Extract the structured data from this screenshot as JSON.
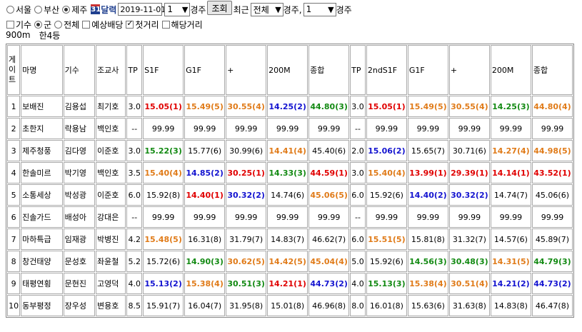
{
  "controls": {
    "regions": [
      {
        "label": "서울",
        "checked": false
      },
      {
        "label": "부산",
        "checked": false
      },
      {
        "label": "제주",
        "checked": true
      }
    ],
    "calendar_icon_text": "31",
    "calendar_label": "달력",
    "date_value": "2019-11-01",
    "race_no": "1",
    "race_label": "경주",
    "search_button": "조회",
    "recent_label": "최근",
    "recent_value": "전체",
    "recent_suffix": "경주,",
    "race_count": "1",
    "race_count_suffix": "경주"
  },
  "filters": [
    {
      "type": "checkbox",
      "label": "기수",
      "checked": false
    },
    {
      "type": "radio",
      "label": "군",
      "checked": true
    },
    {
      "type": "radio",
      "label": "전체",
      "checked": false
    },
    {
      "type": "checkbox",
      "label": "예상배당",
      "checked": false
    },
    {
      "type": "checkbox",
      "label": "첫거리",
      "checked": true
    },
    {
      "type": "checkbox",
      "label": "해당거리",
      "checked": false
    }
  ],
  "race_info": {
    "distance": "900m",
    "grade": "한4등"
  },
  "table": {
    "headers": [
      "게\n이\n트",
      "마명",
      "기수",
      "조교사",
      "TP",
      "S1F",
      "G1F",
      "+",
      "200M",
      "종합",
      "TP",
      "2ndS1F",
      "G1F",
      "+",
      "200M",
      "종합"
    ],
    "rows": [
      {
        "gate": "1",
        "horse": "보배진",
        "jockey": "김용섭",
        "trainer": "최기호",
        "tp": "3.0",
        "cells": [
          [
            "15.05(1)",
            "red"
          ],
          [
            "15.49(5)",
            "orange"
          ],
          [
            "30.55(4)",
            "orange"
          ],
          [
            "14.25(2)",
            "blue"
          ],
          [
            "44.80(3)",
            "green"
          ]
        ],
        "tp2": "3.0",
        "cells2": [
          [
            "15.05(1)",
            "red"
          ],
          [
            "15.49(5)",
            "orange"
          ],
          [
            "30.55(4)",
            "orange"
          ],
          [
            "14.25(3)",
            "green"
          ],
          [
            "44.80(4)",
            "orange"
          ]
        ]
      },
      {
        "gate": "2",
        "horse": "초한지",
        "jockey": "락용남",
        "trainer": "백인호",
        "tp": "--",
        "cells": [
          [
            "99.99",
            "n"
          ],
          [
            "99.99",
            "n"
          ],
          [
            "99.99",
            "n"
          ],
          [
            "99.99",
            "n"
          ],
          [
            "99.99",
            "n"
          ]
        ],
        "tp2": "--",
        "cells2": [
          [
            "99.99",
            "n"
          ],
          [
            "99.99",
            "n"
          ],
          [
            "99.99",
            "n"
          ],
          [
            "99.99",
            "n"
          ],
          [
            "99.99",
            "n"
          ]
        ]
      },
      {
        "gate": "3",
        "horse": "제주청풍",
        "jockey": "김다영",
        "trainer": "이준호",
        "tp": "3.0",
        "cells": [
          [
            "15.22(3)",
            "green"
          ],
          [
            "15.77(6)",
            "n"
          ],
          [
            "30.99(6)",
            "n"
          ],
          [
            "14.41(4)",
            "orange"
          ],
          [
            "45.40(6)",
            "n"
          ]
        ],
        "tp2": "2.0",
        "cells2": [
          [
            "15.06(2)",
            "blue"
          ],
          [
            "15.65(7)",
            "n"
          ],
          [
            "30.71(6)",
            "n"
          ],
          [
            "14.27(4)",
            "orange"
          ],
          [
            "44.98(5)",
            "orange"
          ]
        ]
      },
      {
        "gate": "4",
        "horse": "한솔미르",
        "jockey": "박기영",
        "trainer": "백인호",
        "tp": "3.5",
        "cells": [
          [
            "15.40(4)",
            "orange"
          ],
          [
            "14.85(2)",
            "blue"
          ],
          [
            "30.25(1)",
            "red"
          ],
          [
            "14.33(3)",
            "green"
          ],
          [
            "44.59(1)",
            "red"
          ]
        ],
        "tp2": "3.0",
        "cells2": [
          [
            "15.40(4)",
            "orange"
          ],
          [
            "13.99(1)",
            "red"
          ],
          [
            "29.39(1)",
            "red"
          ],
          [
            "14.14(1)",
            "red"
          ],
          [
            "43.52(1)",
            "red"
          ]
        ]
      },
      {
        "gate": "5",
        "horse": "소통세상",
        "jockey": "박성광",
        "trainer": "이준호",
        "tp": "6.0",
        "cells": [
          [
            "15.92(8)",
            "n"
          ],
          [
            "14.40(1)",
            "red"
          ],
          [
            "30.32(2)",
            "blue"
          ],
          [
            "14.74(6)",
            "n"
          ],
          [
            "45.06(5)",
            "orange"
          ]
        ],
        "tp2": "6.0",
        "cells2": [
          [
            "15.92(6)",
            "n"
          ],
          [
            "14.40(2)",
            "blue"
          ],
          [
            "30.32(2)",
            "blue"
          ],
          [
            "14.74(7)",
            "n"
          ],
          [
            "45.06(6)",
            "n"
          ]
        ]
      },
      {
        "gate": "6",
        "horse": "진솔가드",
        "jockey": "배성아",
        "trainer": "강대은",
        "tp": "--",
        "cells": [
          [
            "99.99",
            "n"
          ],
          [
            "99.99",
            "n"
          ],
          [
            "99.99",
            "n"
          ],
          [
            "99.99",
            "n"
          ],
          [
            "99.99",
            "n"
          ]
        ],
        "tp2": "--",
        "cells2": [
          [
            "99.99",
            "n"
          ],
          [
            "99.99",
            "n"
          ],
          [
            "99.99",
            "n"
          ],
          [
            "99.99",
            "n"
          ],
          [
            "99.99",
            "n"
          ]
        ]
      },
      {
        "gate": "7",
        "horse": "마하특급",
        "jockey": "임재광",
        "trainer": "박병진",
        "tp": "4.2",
        "cells": [
          [
            "15.48(5)",
            "orange"
          ],
          [
            "16.31(8)",
            "n"
          ],
          [
            "31.79(7)",
            "n"
          ],
          [
            "14.83(7)",
            "n"
          ],
          [
            "46.62(7)",
            "n"
          ]
        ],
        "tp2": "6.0",
        "cells2": [
          [
            "15.51(5)",
            "orange"
          ],
          [
            "15.81(8)",
            "n"
          ],
          [
            "31.32(7)",
            "n"
          ],
          [
            "14.57(6)",
            "n"
          ],
          [
            "45.89(7)",
            "n"
          ]
        ]
      },
      {
        "gate": "8",
        "horse": "창건태양",
        "jockey": "문성호",
        "trainer": "좌윤철",
        "tp": "5.2",
        "cells": [
          [
            "15.72(6)",
            "n"
          ],
          [
            "14.90(3)",
            "green"
          ],
          [
            "30.62(5)",
            "orange"
          ],
          [
            "14.42(5)",
            "orange"
          ],
          [
            "45.04(4)",
            "orange"
          ]
        ],
        "tp2": "5.0",
        "cells2": [
          [
            "15.92(6)",
            "n"
          ],
          [
            "14.56(3)",
            "green"
          ],
          [
            "30.48(3)",
            "green"
          ],
          [
            "14.31(5)",
            "orange"
          ],
          [
            "44.79(3)",
            "green"
          ]
        ]
      },
      {
        "gate": "9",
        "horse": "태평연횡",
        "jockey": "문현진",
        "trainer": "고영덕",
        "tp": "4.0",
        "cells": [
          [
            "15.13(2)",
            "blue"
          ],
          [
            "15.38(4)",
            "orange"
          ],
          [
            "30.51(3)",
            "green"
          ],
          [
            "14.21(1)",
            "red"
          ],
          [
            "44.73(2)",
            "blue"
          ]
        ],
        "tp2": "4.0",
        "cells2": [
          [
            "15.13(3)",
            "green"
          ],
          [
            "15.38(4)",
            "orange"
          ],
          [
            "30.51(4)",
            "orange"
          ],
          [
            "14.21(2)",
            "blue"
          ],
          [
            "44.73(2)",
            "blue"
          ]
        ]
      },
      {
        "gate": "10",
        "horse": "동부평정",
        "jockey": "장우성",
        "trainer": "변용호",
        "tp": "8.5",
        "cells": [
          [
            "15.91(7)",
            "n"
          ],
          [
            "16.04(7)",
            "n"
          ],
          [
            "31.95(8)",
            "n"
          ],
          [
            "15.01(8)",
            "n"
          ],
          [
            "46.96(8)",
            "n"
          ]
        ],
        "tp2": "8.0",
        "cells2": [
          [
            "16.01(8)",
            "n"
          ],
          [
            "15.63(6)",
            "n"
          ],
          [
            "31.63(8)",
            "n"
          ],
          [
            "14.83(8)",
            "n"
          ],
          [
            "46.47(8)",
            "n"
          ]
        ]
      }
    ]
  }
}
